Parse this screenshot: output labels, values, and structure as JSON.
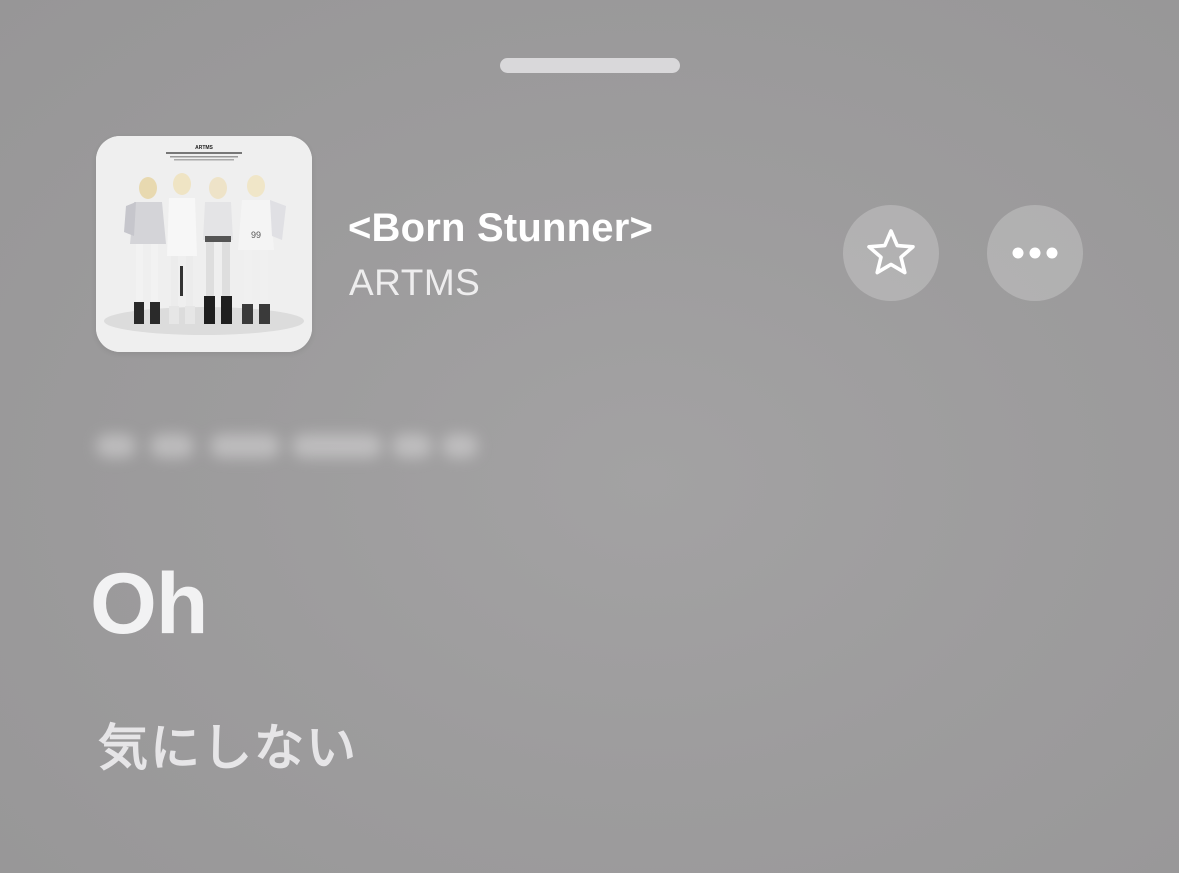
{
  "now_playing": {
    "title": "<Born Stunner>",
    "artist": "ARTMS",
    "artwork": {
      "label": "ARTMS",
      "alt": "album-artwork-four-members"
    },
    "favorite_icon": "star-outline-icon",
    "more_icon": "ellipsis-icon"
  },
  "lyrics": {
    "previous_line": "",
    "current_line": "Oh",
    "translation": "気にしない"
  },
  "colors": {
    "background": "#9d9c9d",
    "title_text": "#ffffff",
    "button_fill": "rgba(255,255,255,0.22)"
  }
}
